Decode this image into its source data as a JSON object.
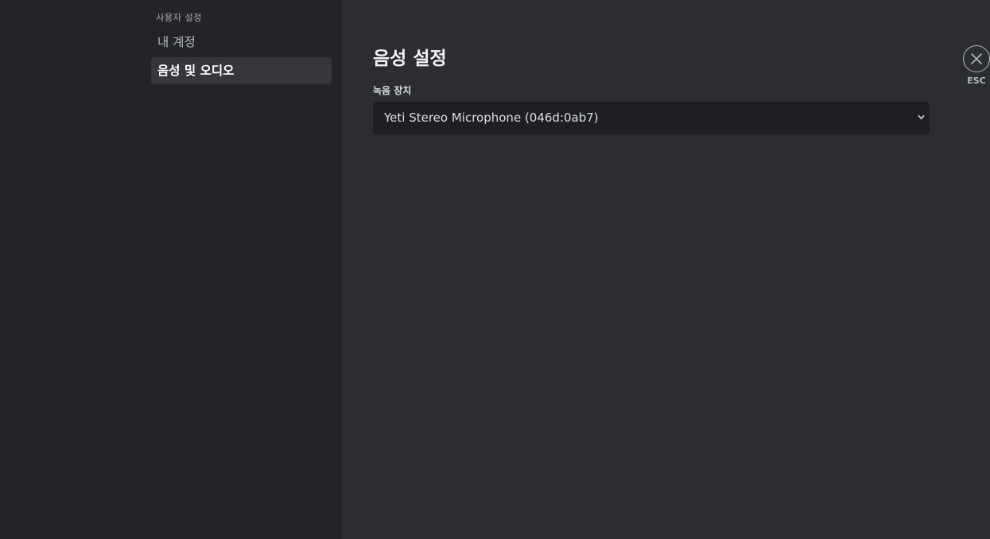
{
  "sidebar": {
    "header": "사용자 설정",
    "items": [
      {
        "label": "내 계정",
        "active": false
      },
      {
        "label": "음성 및 오디오",
        "active": true
      }
    ]
  },
  "main": {
    "title": "음성 설정",
    "input_device": {
      "label": "녹음 장치",
      "value": "Yeti Stereo Microphone (046d:0ab7)"
    }
  },
  "close": {
    "label": "ESC",
    "icon": "close-icon"
  },
  "colors": {
    "sidebar_bg": "#232428",
    "content_bg": "#2b2d31",
    "select_bg": "#1e1f22",
    "active_item_bg": "#35373c"
  }
}
